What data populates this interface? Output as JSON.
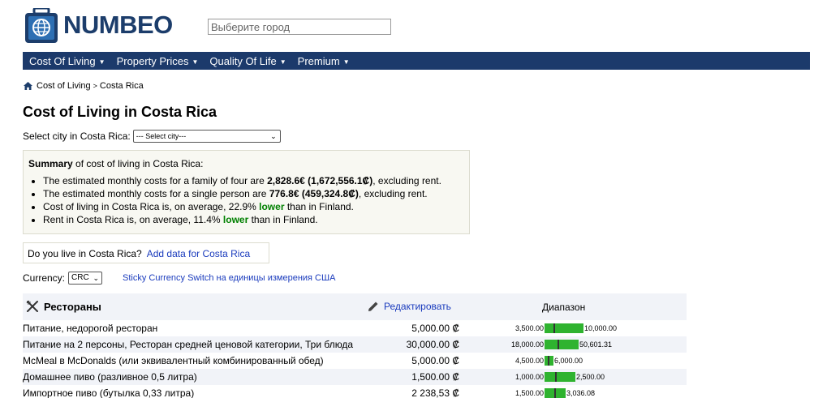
{
  "header": {
    "logo_text": "NUMBEO",
    "search_placeholder": "Выберите город"
  },
  "nav": {
    "items": [
      {
        "label": "Cost Of Living"
      },
      {
        "label": "Property Prices"
      },
      {
        "label": "Quality Of Life"
      },
      {
        "label": "Premium"
      }
    ]
  },
  "breadcrumb": {
    "items": [
      "Cost of Living",
      "Costa Rica"
    ],
    "separator": ">"
  },
  "page_title": "Cost of Living in Costa Rica",
  "city_select": {
    "label": "Select city in Costa Rica:",
    "value": "--- Select city---"
  },
  "summary": {
    "head_bold": "Summary",
    "head_rest": " of cost of living in Costa Rica:",
    "items": [
      {
        "pre": "The estimated monthly costs for a family of four are ",
        "bold": "2,828.6€ (1,672,556.1₡)",
        "post": ", excluding rent."
      },
      {
        "pre": "The estimated monthly costs for a single person are ",
        "bold": "776.8€ (459,324.8₡)",
        "post": ", excluding rent."
      },
      {
        "pre": "Cost of living in Costa Rica is, on average, 22.9% ",
        "bold": "lower",
        "post": " than in Finland."
      },
      {
        "pre": "Rent in Costa Rica is, on average, 11.4% ",
        "bold": "lower",
        "post": " than in Finland."
      }
    ]
  },
  "live_box": {
    "question": "Do you live in Costa Rica?",
    "link": "Add data for Costa Rica"
  },
  "currency": {
    "label": "Currency:",
    "value": "CRC",
    "sticky_link": "Sticky Currency Switch на единицы измерения США"
  },
  "table": {
    "category": "Рестораны",
    "edit_label": "Редактировать",
    "range_header": "Диапазон",
    "rows": [
      {
        "name": "Питание, недорогой ресторан",
        "price": "5,000.00 ₡",
        "min": "3,500.00",
        "max": "10,000.00",
        "bar_fraction": 0.48,
        "marker_fraction": 0.23
      },
      {
        "name": "Питание на 2 персоны, Ресторан средней ценовой категории, Три блюда",
        "price": "30,000.00 ₡",
        "min": "18,000.00",
        "max": "50,601.31",
        "bar_fraction": 0.42,
        "marker_fraction": 0.37
      },
      {
        "name": "McMeal в McDonalds (или эквивалентный комбинированный обед)",
        "price": "5,000.00 ₡",
        "min": "4,500.00",
        "max": "6,000.00",
        "bar_fraction": 0.11,
        "marker_fraction": 0.33
      },
      {
        "name": "Домашнее пиво (разливное 0,5 литра)",
        "price": "1,500.00 ₡",
        "min": "1,000.00",
        "max": "2,500.00",
        "bar_fraction": 0.38,
        "marker_fraction": 0.33
      },
      {
        "name": "Импортное пиво (бутылка 0,33 литра)",
        "price": "2 238,53 ₡",
        "min": "1,500.00",
        "max": "3,036.08",
        "bar_fraction": 0.26,
        "marker_fraction": 0.48
      }
    ]
  }
}
